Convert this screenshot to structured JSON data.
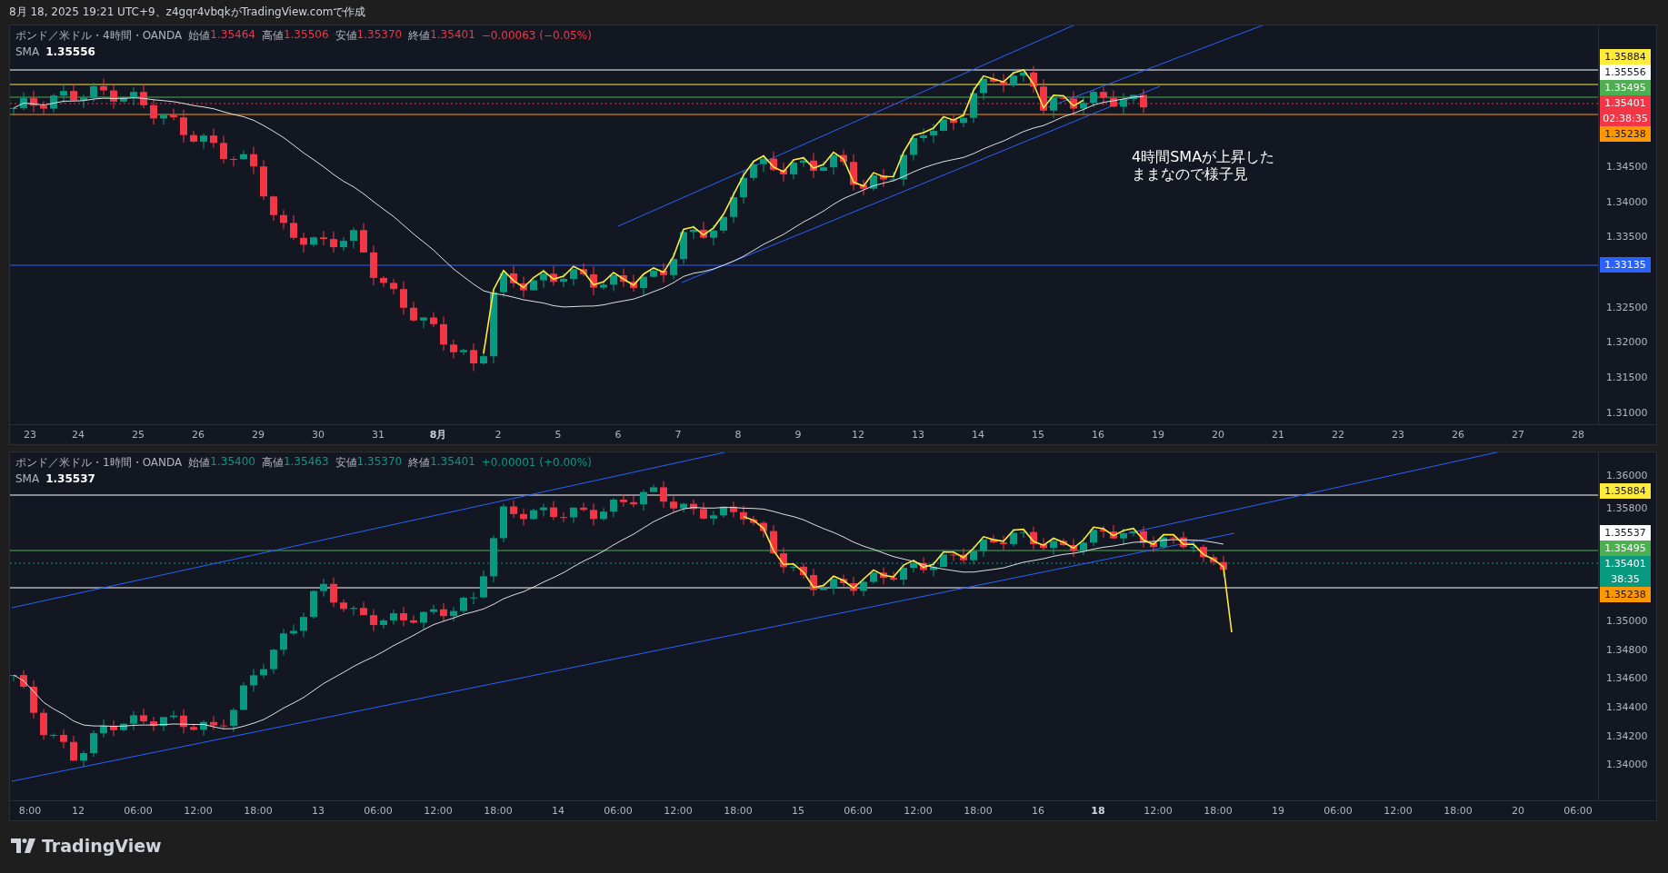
{
  "header": "8月 18, 2025 19:21 UTC+9、z4gqr4vbqkがTradingView.comで作成",
  "panes": [
    {
      "symbol": "ポンド／米ドル・4時間・OANDA",
      "color": "#f23645",
      "change": "−0.00063 (−0.05%)",
      "ohlc": [
        {
          "label": "始値",
          "value": "1.35464"
        },
        {
          "label": "高値",
          "value": "1.35506"
        },
        {
          "label": "安値",
          "value": "1.35370"
        },
        {
          "label": "終値",
          "value": "1.35401"
        }
      ],
      "sma": {
        "label": "SMA",
        "value": "1.35556"
      },
      "note": [
        "4時間SMAが上昇した",
        "ままなので様子見"
      ],
      "price_ticks": [
        "1.34500",
        "1.34000",
        "1.33500",
        "1.32500",
        "1.32000",
        "1.31500",
        "1.31000"
      ],
      "price_tags": [
        {
          "value": "1.35884",
          "color": "#ffeb3b"
        },
        {
          "value": "1.35556",
          "color": "#ffffff"
        },
        {
          "value": "1.35495",
          "color": "#4caf50"
        },
        {
          "value": "1.35401",
          "timer": "02:38:35",
          "color": "#f23645"
        },
        {
          "value": "1.35238",
          "color": "#ff9800"
        },
        {
          "value": "1.33135",
          "color": "#2962ff"
        }
      ],
      "time_labels": [
        {
          "text": "23",
          "kind": "day"
        },
        {
          "text": "24",
          "kind": "day"
        },
        {
          "text": "25",
          "kind": "day"
        },
        {
          "text": "26",
          "kind": "day"
        },
        {
          "text": "29",
          "kind": "day"
        },
        {
          "text": "30",
          "kind": "day"
        },
        {
          "text": "31",
          "kind": "day"
        },
        {
          "text": "8月",
          "kind": "major"
        },
        {
          "text": "2",
          "kind": "day"
        },
        {
          "text": "5",
          "kind": "day"
        },
        {
          "text": "6",
          "kind": "day"
        },
        {
          "text": "7",
          "kind": "day"
        },
        {
          "text": "8",
          "kind": "day"
        },
        {
          "text": "9",
          "kind": "day"
        },
        {
          "text": "12",
          "kind": "day"
        },
        {
          "text": "13",
          "kind": "day"
        },
        {
          "text": "14",
          "kind": "day"
        },
        {
          "text": "15",
          "kind": "day"
        },
        {
          "text": "16",
          "kind": "day"
        },
        {
          "text": "19",
          "kind": "day"
        },
        {
          "text": "20",
          "kind": "day"
        },
        {
          "text": "21",
          "kind": "day"
        },
        {
          "text": "22",
          "kind": "day"
        },
        {
          "text": "23",
          "kind": "day"
        },
        {
          "text": "26",
          "kind": "day"
        },
        {
          "text": "27",
          "kind": "day"
        },
        {
          "text": "28",
          "kind": "day"
        }
      ]
    },
    {
      "symbol": "ポンド／米ドル・1時間・OANDA",
      "color": "#089981",
      "change": "+0.00001 (+0.00%)",
      "ohlc": [
        {
          "label": "始値",
          "value": "1.35400"
        },
        {
          "label": "高値",
          "value": "1.35463"
        },
        {
          "label": "安値",
          "value": "1.35370"
        },
        {
          "label": "終値",
          "value": "1.35401"
        }
      ],
      "sma": {
        "label": "SMA",
        "value": "1.35537"
      },
      "price_ticks": [
        "1.36000",
        "1.35800",
        "1.35000",
        "1.34800",
        "1.34600",
        "1.34400",
        "1.34200",
        "1.34000"
      ],
      "price_tags": [
        {
          "value": "1.35884",
          "color": "#ffeb3b"
        },
        {
          "value": "1.35537",
          "color": "#ffffff"
        },
        {
          "value": "1.35495",
          "color": "#4caf50"
        },
        {
          "value": "1.35401",
          "timer": "38:35",
          "color": "#089981"
        },
        {
          "value": "1.35238",
          "color": "#ff9800"
        }
      ],
      "time_labels": [
        {
          "text": "8:00",
          "kind": "time"
        },
        {
          "text": "12",
          "kind": "day"
        },
        {
          "text": "06:00",
          "kind": "time"
        },
        {
          "text": "12:00",
          "kind": "time"
        },
        {
          "text": "18:00",
          "kind": "time"
        },
        {
          "text": "13",
          "kind": "day"
        },
        {
          "text": "06:00",
          "kind": "time"
        },
        {
          "text": "12:00",
          "kind": "time"
        },
        {
          "text": "18:00",
          "kind": "time"
        },
        {
          "text": "14",
          "kind": "day"
        },
        {
          "text": "06:00",
          "kind": "time"
        },
        {
          "text": "12:00",
          "kind": "time"
        },
        {
          "text": "18:00",
          "kind": "time"
        },
        {
          "text": "15",
          "kind": "day"
        },
        {
          "text": "06:00",
          "kind": "time"
        },
        {
          "text": "12:00",
          "kind": "time"
        },
        {
          "text": "18:00",
          "kind": "time"
        },
        {
          "text": "16",
          "kind": "day"
        },
        {
          "text": "18",
          "kind": "major"
        },
        {
          "text": "12:00",
          "kind": "time"
        },
        {
          "text": "18:00",
          "kind": "time"
        },
        {
          "text": "19",
          "kind": "day"
        },
        {
          "text": "06:00",
          "kind": "time"
        },
        {
          "text": "12:00",
          "kind": "time"
        },
        {
          "text": "18:00",
          "kind": "time"
        },
        {
          "text": "20",
          "kind": "day"
        },
        {
          "text": "06:00",
          "kind": "time"
        }
      ]
    }
  ],
  "footer": {
    "brand": "TradingView"
  }
}
